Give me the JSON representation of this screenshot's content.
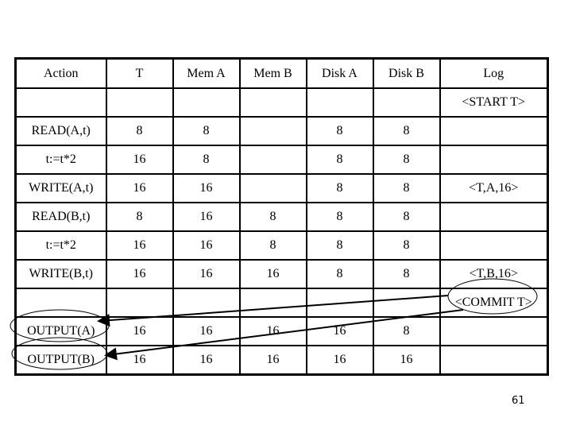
{
  "table": {
    "headers": [
      "Action",
      "T",
      "Mem A",
      "Mem B",
      "Disk A",
      "Disk B",
      "Log"
    ],
    "rows": [
      [
        "",
        "",
        "",
        "",
        "",
        "",
        "<START T>"
      ],
      [
        "READ(A,t)",
        "8",
        "8",
        "",
        "8",
        "8",
        ""
      ],
      [
        "t:=t*2",
        "16",
        "8",
        "",
        "8",
        "8",
        ""
      ],
      [
        "WRITE(A,t)",
        "16",
        "16",
        "",
        "8",
        "8",
        "<T,A,16>"
      ],
      [
        "READ(B,t)",
        "8",
        "16",
        "8",
        "8",
        "8",
        ""
      ],
      [
        "t:=t*2",
        "16",
        "16",
        "8",
        "8",
        "8",
        ""
      ],
      [
        "WRITE(B,t)",
        "16",
        "16",
        "16",
        "8",
        "8",
        "<T,B,16>"
      ],
      [
        "",
        "",
        "",
        "",
        "",
        "",
        "<COMMIT T>"
      ],
      [
        "OUTPUT(A)",
        "16",
        "16",
        "16",
        "16",
        "8",
        ""
      ],
      [
        "OUTPUT(B)",
        "16",
        "16",
        "16",
        "16",
        "16",
        ""
      ]
    ]
  },
  "annotations": {
    "circled": [
      "OUTPUT(A)",
      "OUTPUT(B)",
      "<COMMIT T>"
    ],
    "arrows": [
      {
        "from": "<COMMIT T>",
        "to": "OUTPUT(A)"
      },
      {
        "from": "<COMMIT T>",
        "to": "OUTPUT(B)"
      }
    ]
  },
  "page_number": "61"
}
